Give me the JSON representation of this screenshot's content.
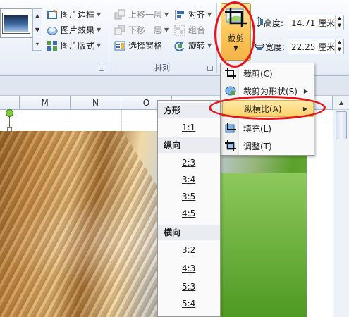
{
  "ribbon": {
    "picture_styles": {
      "border_label": "图片边框",
      "effects_label": "图片效果",
      "layout_label": "图片版式"
    },
    "arrange": {
      "bring_forward_label": "上移一层",
      "send_backward_label": "下移一层",
      "selection_pane_label": "选择窗格",
      "align_label": "对齐",
      "group_label": "组合",
      "rotate_label": "旋转",
      "group_title": "排列"
    },
    "crop_button_label": "裁剪",
    "size": {
      "height_label": "高度:",
      "height_value": "14.71 厘米",
      "width_label": "宽度:",
      "width_value": "22.25 厘米"
    }
  },
  "sheet": {
    "columns": [
      "M",
      "N",
      "O"
    ]
  },
  "crop_menu": {
    "items": [
      {
        "label": "裁剪(C)",
        "icon": "crop-icon"
      },
      {
        "label": "裁剪为形状(S)",
        "icon": "shape-icon",
        "submenu": true
      },
      {
        "label": "纵横比(A)",
        "icon": "",
        "submenu": true,
        "highlighted": true
      },
      {
        "label": "填充(L)",
        "icon": "fill-icon"
      },
      {
        "label": "调整(T)",
        "icon": "fit-icon"
      }
    ]
  },
  "aspect_menu": {
    "square_header": "方形",
    "square_items": [
      "1:1"
    ],
    "portrait_header": "纵向",
    "portrait_items": [
      "2:3",
      "3:4",
      "3:5",
      "4:5"
    ],
    "landscape_header": "横向",
    "landscape_items": [
      "3:2",
      "4:3",
      "5:3",
      "5:4"
    ]
  },
  "colors": {
    "highlight": "#fad36b",
    "annotation_red": "#e3141d"
  }
}
